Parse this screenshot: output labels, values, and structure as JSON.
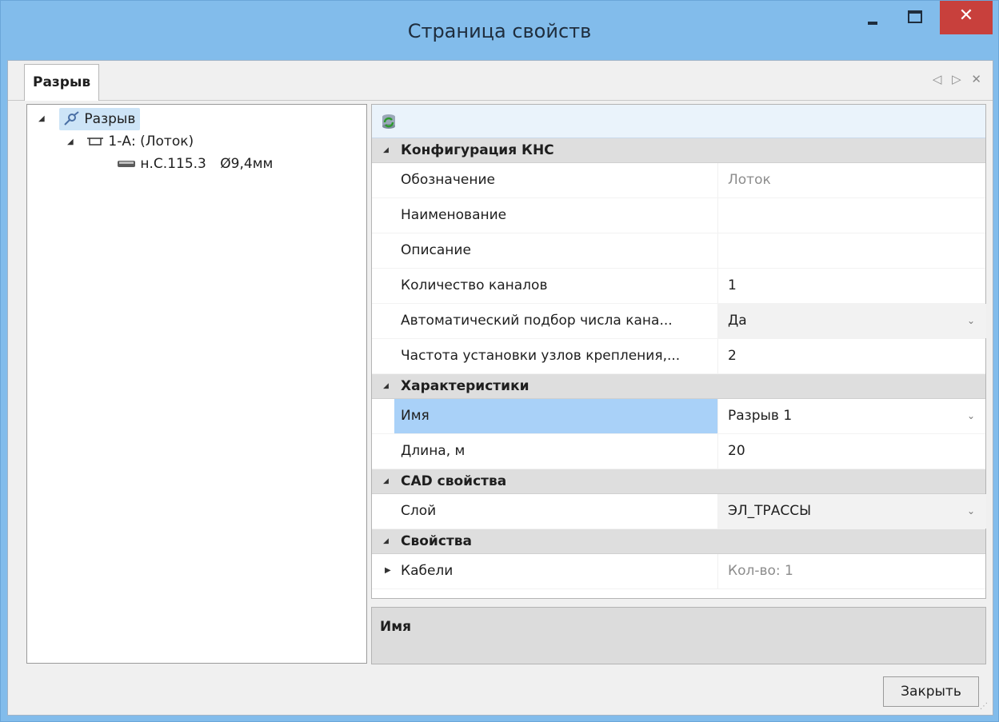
{
  "window": {
    "title": "Страница свойств",
    "minimize_icon": "minimize-icon",
    "maximize_icon": "maximize-icon",
    "close_glyph": "✕"
  },
  "tabs": {
    "active_label": "Разрыв",
    "nav_glyph": "◁ ▷ ✕"
  },
  "tree": {
    "root": {
      "label": "Разрыв",
      "icon": "break-icon"
    },
    "child": {
      "label": "1-А: (Лоток)",
      "icon": "tray-icon"
    },
    "leaf": {
      "label": "н.С.115.3",
      "suffix": "Ø9,4мм",
      "icon": "cable-icon"
    }
  },
  "propgrid": {
    "toolbar_icon": "refresh-database-icon",
    "categories": [
      {
        "name": "Конфигурация КНС",
        "rows": [
          {
            "name": "Обозначение",
            "value": "Лоток",
            "dim": true,
            "combo": false
          },
          {
            "name": "Наименование",
            "value": "",
            "dim": false,
            "combo": false
          },
          {
            "name": "Описание",
            "value": "",
            "dim": false,
            "combo": false
          },
          {
            "name": "Количество каналов",
            "value": "1",
            "dim": false,
            "combo": false
          },
          {
            "name": "Автоматический подбор числа кана...",
            "value": "Да",
            "dim": false,
            "combo": true
          },
          {
            "name": "Частота установки узлов крепления,...",
            "value": "2",
            "dim": false,
            "combo": false
          }
        ]
      },
      {
        "name": "Характеристики",
        "rows": [
          {
            "name": "Имя",
            "value": "Разрыв 1",
            "dim": false,
            "combo": true,
            "selected": true
          },
          {
            "name": "Длина, м",
            "value": "20",
            "dim": false,
            "combo": false
          }
        ]
      },
      {
        "name": "CAD свойства",
        "rows": [
          {
            "name": "Слой",
            "value": "ЭЛ_ТРАССЫ",
            "dim": false,
            "combo": true
          }
        ]
      },
      {
        "name": "Свойства",
        "rows": [
          {
            "name": "Кабели",
            "value": "Кол-во: 1",
            "dim": true,
            "combo": false,
            "expandable": true
          }
        ]
      }
    ]
  },
  "description": {
    "title": "Имя"
  },
  "buttons": {
    "close_label": "Закрыть"
  },
  "colors": {
    "titlebar": "#82bceb",
    "close_button": "#c8403c",
    "selection": "#a9d1f8",
    "tree_selection": "#cde4f7",
    "category_bg": "#dedede"
  }
}
